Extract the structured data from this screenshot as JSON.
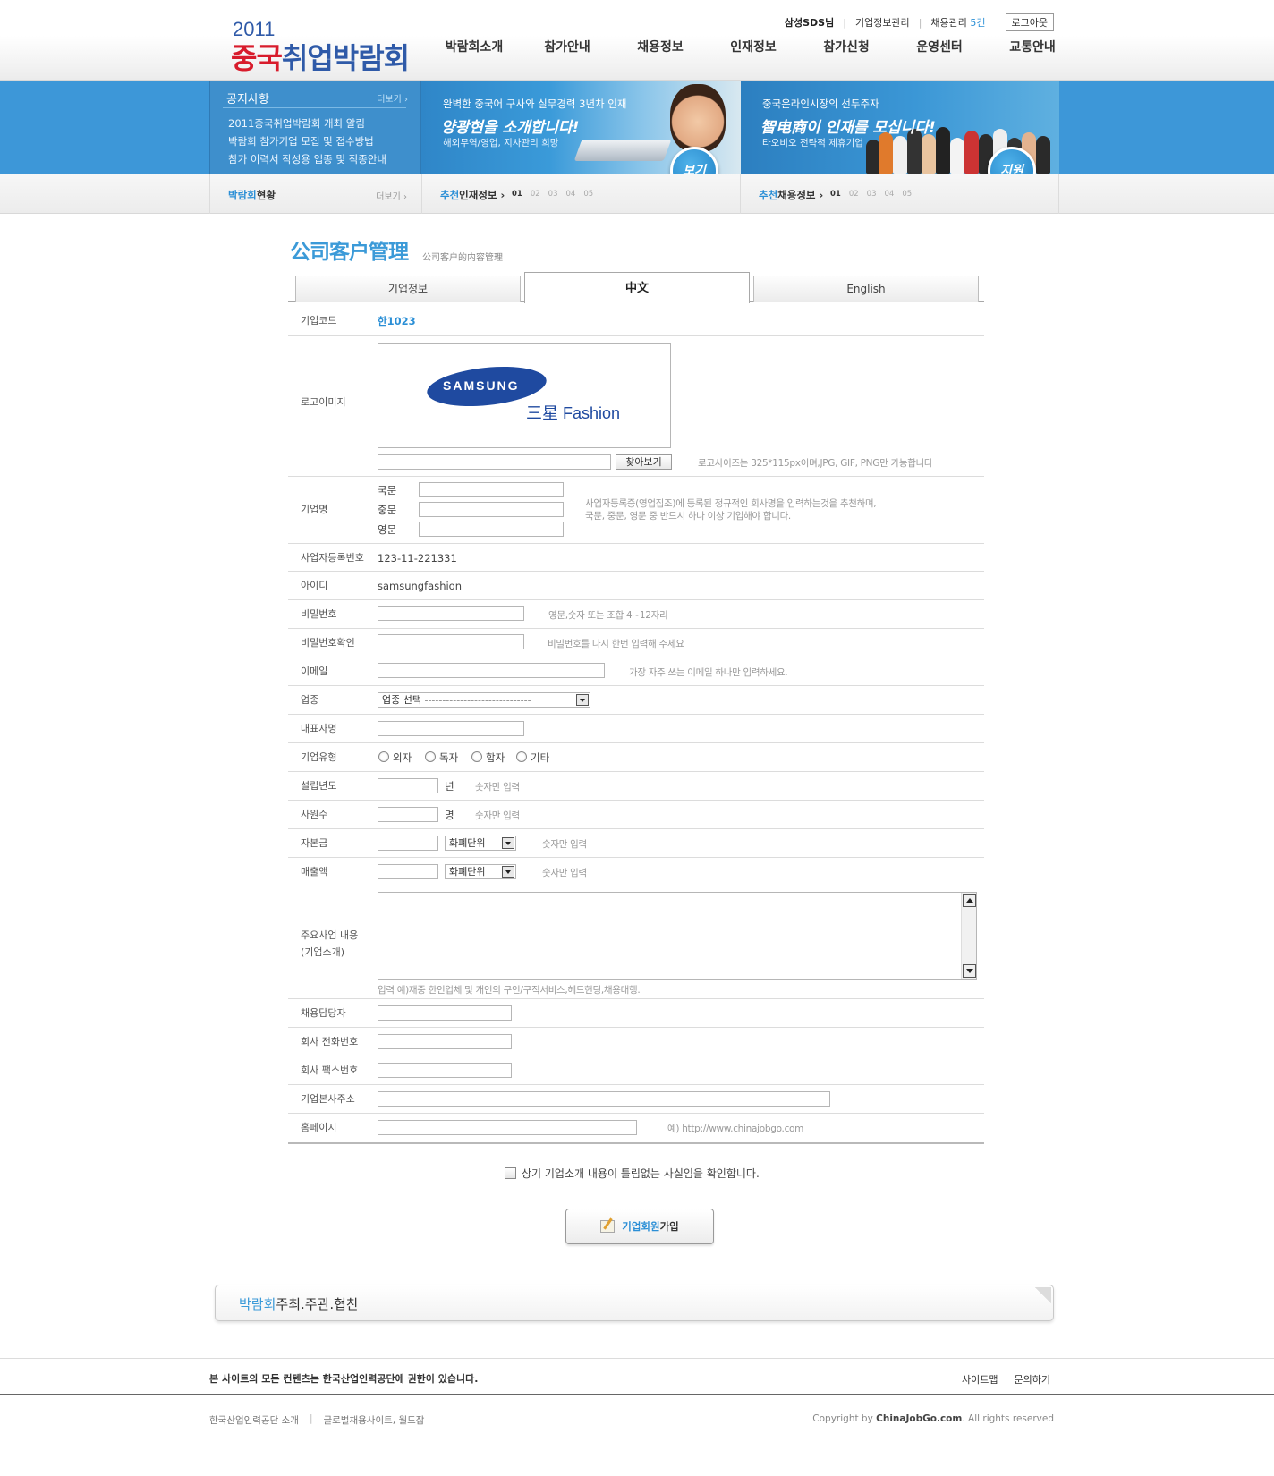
{
  "header": {
    "logo_year": "2011",
    "logo_red": "중국",
    "logo_blue": "취업박람회",
    "util": {
      "user": "삼성SDS님",
      "company_info": "기업정보관리",
      "recruit_manage": "채용관리",
      "recruit_count": "5건",
      "logout": "로그아웃"
    },
    "gnb": [
      "박람회소개",
      "참가안내",
      "채용정보",
      "인재정보",
      "참가신청",
      "운영센터",
      "교통안내"
    ]
  },
  "notice": {
    "title": "공지사항",
    "more": "더보기 ›",
    "items": [
      "2011중국취업박람회 개최 알림",
      "박람회 참가기업 모집 및 접수방법",
      "참가 이력서 작성용 업종 및 직종안내"
    ]
  },
  "banner1": {
    "small": "완벽한 중국어 구사와 실무경력 3년차 인재",
    "big": "양광현을 소개합니다!",
    "sub": "해외무역/영업, 지사관리 희망",
    "badge": "보기"
  },
  "banner2": {
    "small": "중국온라인시장의 선두주자",
    "big": "智电商이 인재를 모십니다!",
    "sub": "타오비오 전략적 제휴기업",
    "badge": "지원"
  },
  "subbar": {
    "expo_status_blue": "박람회",
    "expo_status_rest": "현황",
    "expo_more": "더보기 ›",
    "talent_blue": "추천",
    "talent_rest": "인재정보 ›",
    "jobs_blue": "추천",
    "jobs_rest": "채용정보 ›",
    "pages": [
      "01",
      "02",
      "03",
      "04",
      "05"
    ]
  },
  "page": {
    "title": "公司客户管理",
    "subtitle": "公司客户的内容管理"
  },
  "tabs": [
    "기업정보",
    "中文",
    "English"
  ],
  "form": {
    "company_code_label": "기업코드",
    "company_code": "한1023",
    "logo_label": "로고이미지",
    "logo_brand": "SAMSUNG",
    "logo_sub": "三星 Fashion",
    "find_button": "찾아보기",
    "logo_hint": "로고사이즈는 325*115px이며,JPG, GIF, PNG만 가능합니다",
    "company_name_label": "기업명",
    "name_korean": "국문",
    "name_chinese": "중문",
    "name_english": "영문",
    "name_hint_1": "사업자등록증(영업집조)에 등록된 정규적인 회사명을 입력하는것을 추천하며,",
    "name_hint_2": "국문, 중문, 영문 중 반드시 하나 이상 기입해야 합니다.",
    "biz_no_label": "사업자등록번호",
    "biz_no": "123-11-221331",
    "id_label": "아이디",
    "id_value": "samsungfashion",
    "pw_label": "비밀번호",
    "pw_hint": "영문,숫자 또는 조합 4~12자리",
    "pw_confirm_label": "비밀번호확인",
    "pw_confirm_hint": "비밀번호를 다시 한번 입력해 주세요",
    "email_label": "이메일",
    "email_hint": "가장 자주 쓰는 이메일 하나만 입력하세요.",
    "industry_label": "업종",
    "industry_select": "업종 선택 ------------------------------",
    "rep_label": "대표자명",
    "type_label": "기업유형",
    "type_options": [
      "외자",
      "독자",
      "합자",
      "기타"
    ],
    "year_label": "설립년도",
    "year_unit": "년",
    "year_hint": "숫자만 입력",
    "staff_label": "사원수",
    "staff_unit": "명",
    "staff_hint": "숫자만 입력",
    "capital_label": "자본금",
    "capital_currency": "화폐단위",
    "capital_hint": "숫자만 입력",
    "sales_label": "매출액",
    "sales_currency": "화폐단위",
    "sales_hint": "숫자만 입력",
    "business_label_1": "주요사업 내용",
    "business_label_2": "(기업소개)",
    "business_hint": "입력 예)재중 한인업체 및 개인의 구인/구직서비스,헤드헌팅,채용대행.",
    "hr_label": "채용담당자",
    "phone_label": "회사 전화번호",
    "fax_label": "회사 팩스번호",
    "address_label": "기업본사주소",
    "homepage_label": "홈페이지",
    "homepage_hint": "예) http://www.chinajobgo.com"
  },
  "agree_text": "상기 기업소개 내용이 틀림없는 사실임을 확인합니다.",
  "join_button": {
    "blue": "기업회원",
    "rest": "가입"
  },
  "sponsor": {
    "blue": "박람회",
    "rest": "주최.주관.협찬"
  },
  "footer": {
    "notice": "본 사이트의 모든 컨텐츠는 한국산업인력공단에 권한이 있습니다.",
    "links": [
      "사이트맵",
      "문의하기"
    ],
    "left_1": "한국산업인력공단 소개",
    "left_2": "글로벌채용사이트, 월드잡",
    "copyright_pre": "Copyright by ",
    "copyright_site": "ChinaJobGo.com",
    "copyright_post": ". All rights reserved"
  },
  "colors": {
    "brand_blue": "#3b9ad8",
    "band_blue": "#3d97d8",
    "logo_red": "#d81c2c"
  }
}
